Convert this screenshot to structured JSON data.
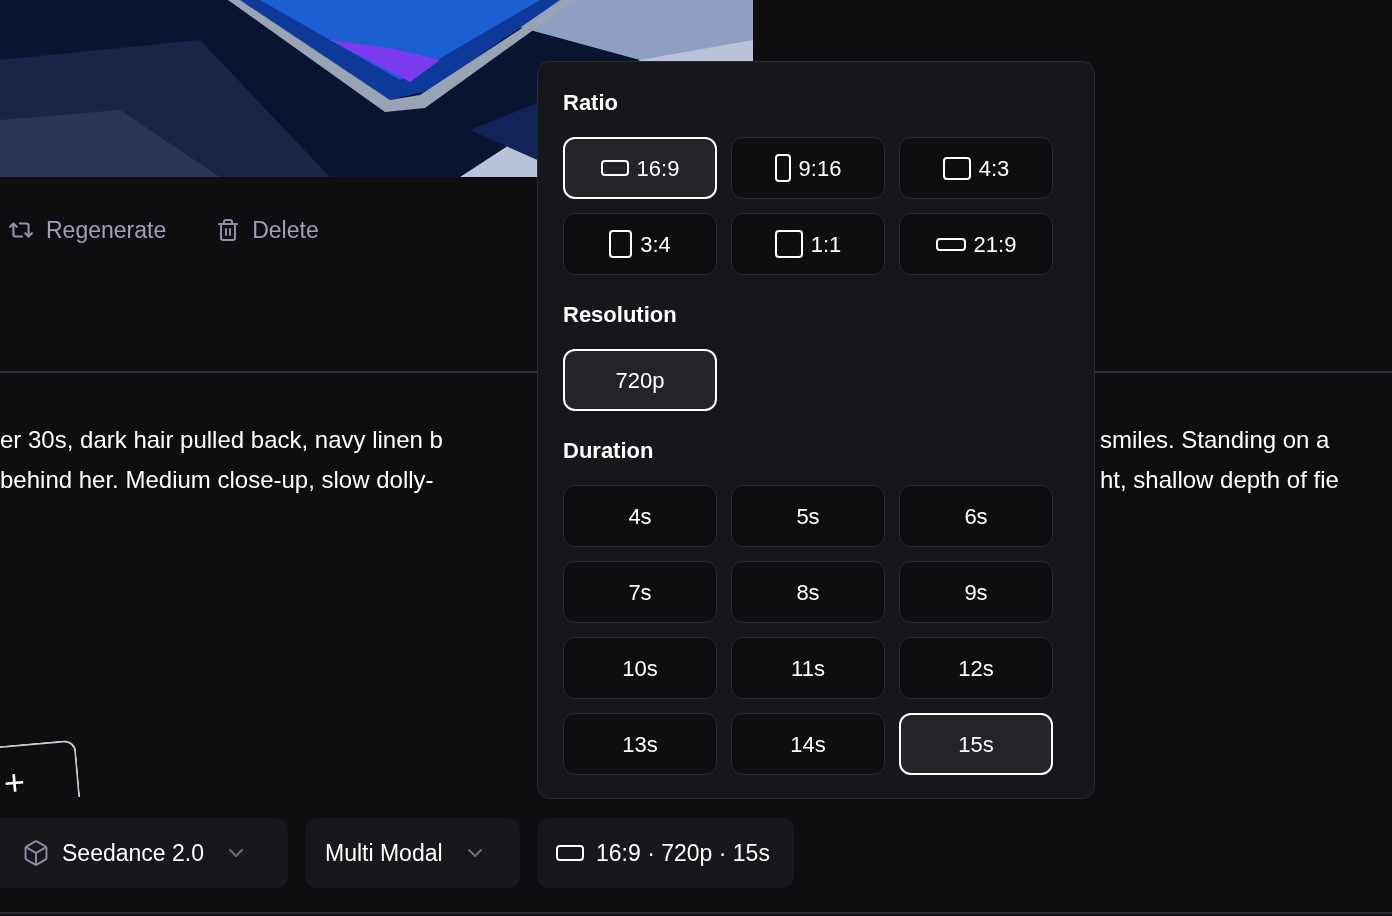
{
  "media_actions": [
    {
      "kind": "regenerate",
      "label": "Regenerate"
    },
    {
      "kind": "delete",
      "label": "Delete"
    }
  ],
  "prompt": {
    "lines": [
      {
        "left": "er 30s, dark hair pulled back, navy linen b",
        "right": "smiles. Standing on a"
      },
      {
        "left": "behind her. Medium close-up, slow dolly-",
        "right": "ht, shallow depth of fie"
      }
    ]
  },
  "add_button": {
    "label": "+"
  },
  "toolbar": [
    {
      "kind": "model",
      "label": "Seedance 2.0"
    },
    {
      "kind": "mode",
      "label": "Multi Modal"
    },
    {
      "kind": "settings",
      "label": "16:9 · 720p · 15s"
    }
  ],
  "settings_popover": {
    "sections": [
      {
        "title": "Ratio",
        "options": [
          {
            "label": "16:9",
            "kind": "wide",
            "selected": true
          },
          {
            "label": "9:16",
            "kind": "tall",
            "selected": false
          },
          {
            "label": "4:3",
            "kind": "landscape",
            "selected": false
          },
          {
            "label": "3:4",
            "kind": "portrait",
            "selected": false
          },
          {
            "label": "1:1",
            "kind": "square",
            "selected": false
          },
          {
            "label": "21:9",
            "kind": "ultrawide",
            "selected": false
          }
        ]
      },
      {
        "title": "Resolution",
        "options": [
          {
            "label": "720p",
            "selected": true
          }
        ]
      },
      {
        "title": "Duration",
        "options": [
          {
            "label": "4s",
            "selected": false
          },
          {
            "label": "5s",
            "selected": false
          },
          {
            "label": "6s",
            "selected": false
          },
          {
            "label": "7s",
            "selected": false
          },
          {
            "label": "8s",
            "selected": false
          },
          {
            "label": "9s",
            "selected": false
          },
          {
            "label": "10s",
            "selected": false
          },
          {
            "label": "11s",
            "selected": false
          },
          {
            "label": "12s",
            "selected": false
          },
          {
            "label": "13s",
            "selected": false
          },
          {
            "label": "14s",
            "selected": false
          },
          {
            "label": "15s",
            "selected": true
          }
        ]
      }
    ]
  }
}
